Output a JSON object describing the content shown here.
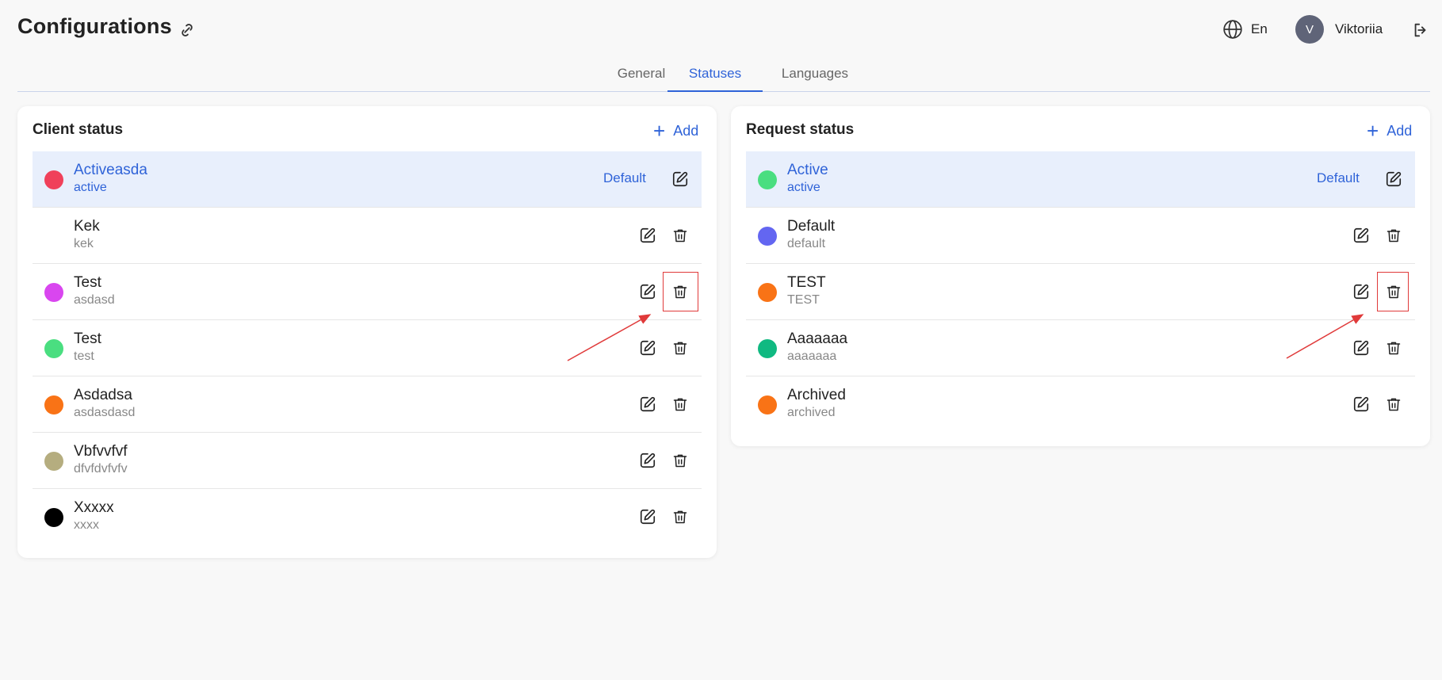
{
  "header": {
    "title": "Configurations",
    "language": "En",
    "user": {
      "initial": "V",
      "name": "Viktoriia"
    }
  },
  "tabs": [
    {
      "label": "General",
      "active": false
    },
    {
      "label": "Statuses",
      "active": true
    },
    {
      "label": "Languages",
      "active": false
    }
  ],
  "client_status": {
    "title": "Client status",
    "add_label": "Add",
    "default_label": "Default",
    "items": [
      {
        "name": "Activeasda",
        "code": "active",
        "color": "#f0405a",
        "default": true
      },
      {
        "name": "Kek",
        "code": "kek",
        "color": "",
        "default": false
      },
      {
        "name": "Test",
        "code": "asdasd",
        "color": "#d946ef",
        "default": false
      },
      {
        "name": "Test",
        "code": "test",
        "color": "#4ade80",
        "default": false
      },
      {
        "name": "Asdadsa",
        "code": "asdasdasd",
        "color": "#f97316",
        "default": false
      },
      {
        "name": "Vbfvvfvf",
        "code": "dfvfdvfvfv",
        "color": "#b5ad7f",
        "default": false
      },
      {
        "name": "Xxxxx",
        "code": "xxxx",
        "color": "#000000",
        "default": false
      }
    ]
  },
  "request_status": {
    "title": "Request status",
    "add_label": "Add",
    "default_label": "Default",
    "items": [
      {
        "name": "Active",
        "code": "active",
        "color": "#4ade80",
        "default": true
      },
      {
        "name": "Default",
        "code": "default",
        "color": "#6366f1",
        "default": false
      },
      {
        "name": "TEST",
        "code": "TEST",
        "color": "#f97316",
        "default": false
      },
      {
        "name": "Aaaaaaa",
        "code": "aaaaaaa",
        "color": "#10b981",
        "default": false
      },
      {
        "name": "Archived",
        "code": "archived",
        "color": "#f97316",
        "default": false
      }
    ]
  },
  "colors": {
    "accent": "#2f63d8",
    "annotation": "#e03a3a"
  }
}
